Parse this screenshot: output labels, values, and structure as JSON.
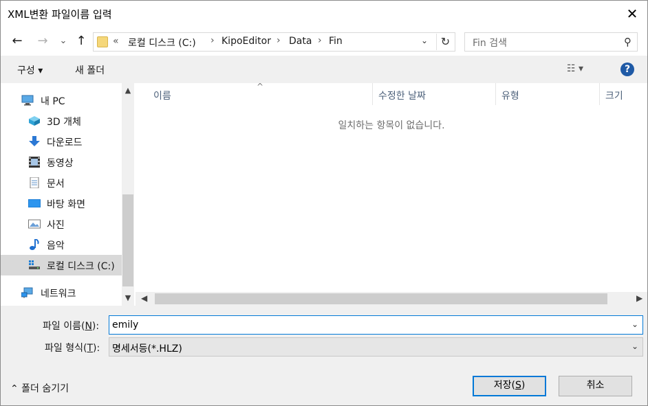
{
  "window": {
    "title": "XML변환 파일이름 입력",
    "close": "✕"
  },
  "nav": {
    "back": "←",
    "forward": "→",
    "recent": "⌄",
    "up": "↑",
    "address": {
      "prefix": "«",
      "crumbs": [
        "로컬 디스크 (C:)",
        "KipoEditor",
        "Data",
        "Fin"
      ],
      "sep": "›",
      "dropdown": "⌄",
      "refresh": "↻"
    },
    "search": {
      "placeholder": "Fin 검색",
      "icon": "⚲"
    }
  },
  "toolbar": {
    "organize": "구성 ▾",
    "new_folder": "새 폴더",
    "view": "☷ ▾",
    "help": "?"
  },
  "sidebar": {
    "items": [
      {
        "label": "내 PC",
        "icon": "pc-icon"
      },
      {
        "label": "3D 개체",
        "icon": "cube-icon"
      },
      {
        "label": "다운로드",
        "icon": "download-icon"
      },
      {
        "label": "동영상",
        "icon": "video-icon"
      },
      {
        "label": "문서",
        "icon": "document-icon"
      },
      {
        "label": "바탕 화면",
        "icon": "desktop-icon"
      },
      {
        "label": "사진",
        "icon": "pictures-icon"
      },
      {
        "label": "음악",
        "icon": "music-icon"
      },
      {
        "label": "로컬 디스크 (C:)",
        "icon": "drive-icon"
      },
      {
        "label": "네트워크",
        "icon": "network-icon"
      }
    ]
  },
  "columns": {
    "name": "이름",
    "modified": "수정한 날짜",
    "type": "유형",
    "size": "크기",
    "sort": "^"
  },
  "file_list": {
    "empty_text": "일치하는 항목이 없습니다."
  },
  "form": {
    "filename_label_pre": "파일 이름(",
    "filename_label_key": "N",
    "filename_label_post": "):",
    "filename_value": "emily",
    "filetype_label_pre": "파일 형식(",
    "filetype_label_key": "T",
    "filetype_label_post": "):",
    "filetype_value": "명세서등(*.HLZ)"
  },
  "footer": {
    "hide_folders": "⌃  폴더 숨기기",
    "save_pre": "저장(",
    "save_key": "S",
    "save_post": ")",
    "cancel": "취소"
  },
  "colors": {
    "accent": "#0078d7",
    "selected": "#d9d9d9",
    "header_text": "#4c607a"
  }
}
